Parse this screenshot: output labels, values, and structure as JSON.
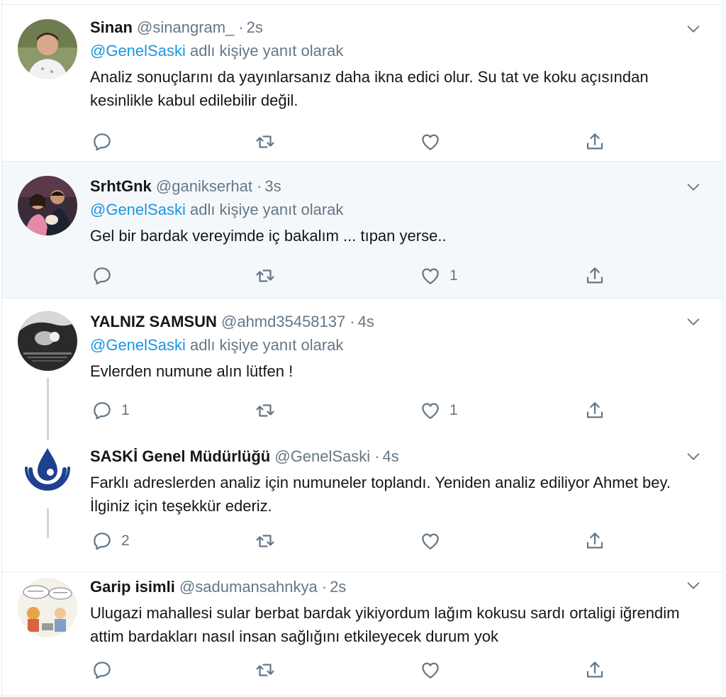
{
  "reply_prefix_suffix": "adlı kişiye yanıt olarak",
  "tweets": [
    {
      "name": "Sinan",
      "handle": "@sinangram_",
      "dot": "·",
      "time": "2s",
      "reply_to": "@GenelSaski",
      "text": "Analiz sonuçlarını da yayınlarsanız daha ikna edici olur. Su tat ve koku açısından kesinlikle kabul edilebilir değil.",
      "reply_count": "",
      "retweet_count": "",
      "like_count": ""
    },
    {
      "name": "SrhtGnk",
      "handle": "@ganikserhat",
      "dot": "·",
      "time": "3s",
      "reply_to": "@GenelSaski",
      "text": "Gel bir bardak vereyimde iç bakalım ... tıpan yerse..",
      "reply_count": "",
      "retweet_count": "",
      "like_count": "1"
    },
    {
      "name": "YALNIZ SAMSUN",
      "handle": "@ahmd35458137",
      "dot": "·",
      "time": "4s",
      "reply_to": "@GenelSaski",
      "text": "Evlerden numune alın lütfen !",
      "reply_count": "1",
      "retweet_count": "",
      "like_count": "1"
    },
    {
      "name": "SASKİ Genel Müdürlüğü",
      "handle": "@GenelSaski",
      "dot": "·",
      "time": "4s",
      "reply_to": "",
      "text": "Farklı adreslerden analiz için numuneler toplandı. Yeniden analiz ediliyor Ahmet bey. İlginiz için teşekkür ederiz.",
      "reply_count": "2",
      "retweet_count": "",
      "like_count": ""
    },
    {
      "name": "Garip isimli",
      "handle": "@sadumansahnkya",
      "dot": "·",
      "time": "2s",
      "reply_to": "",
      "text": "Ulugazi mahallesi sular berbat bardak  yikiyordum lağım kokusu sardı ortaligi iğrendim attim bardakları nasıl insan sağlığını etkileyecek durum yok",
      "reply_count": "",
      "retweet_count": "",
      "like_count": ""
    }
  ],
  "icons": {
    "reply": "reply-icon",
    "retweet": "retweet-icon",
    "like": "like-icon",
    "share": "share-icon",
    "caret": "chevron-down-icon"
  },
  "colors": {
    "mention": "#1b95e0",
    "muted": "#657786",
    "text": "#14171a",
    "highlight_bg": "#f5f8fa",
    "border": "#e6ecf0"
  }
}
